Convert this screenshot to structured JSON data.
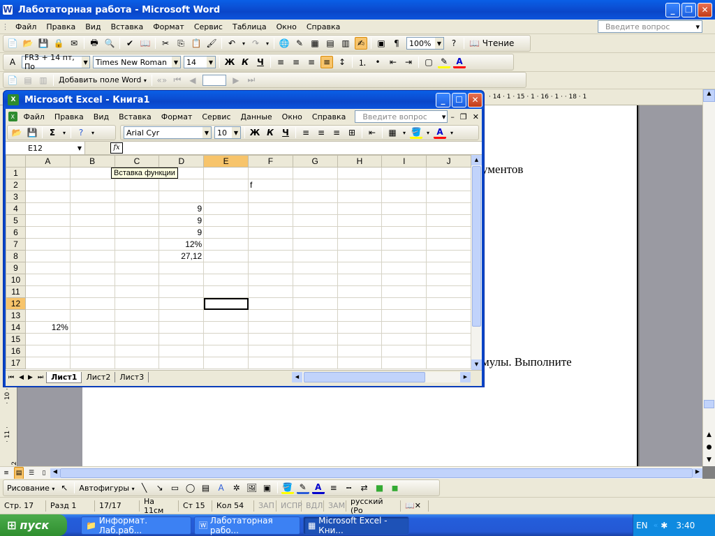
{
  "word": {
    "title": "Лаботаторная работа - Microsoft Word",
    "menu": [
      "Файл",
      "Правка",
      "Вид",
      "Вставка",
      "Формат",
      "Сервис",
      "Таблица",
      "Окно",
      "Справка"
    ],
    "ask_placeholder": "Введите вопрос",
    "zoom": "100%",
    "reading": "Чтение",
    "style": "FR3 + 14 пт, По",
    "font": "Times New Roman",
    "size": "14",
    "add_field": "Добавить поле Word",
    "ruler_text": "· 14 · 1 · 15 · 1 · 16 · 1 ·   · 18 · 1",
    "doc_line1": "ументов",
    "doc_line2": "мулы.  Выполните",
    "vruler": [
      "· 10 ·",
      "· 11 ·",
      "· 12 ·"
    ],
    "drawing": "Рисование",
    "autoshapes": "Автофигуры",
    "status": [
      "Стр. 17",
      "Разд 1",
      "17/17",
      "На 11см",
      "Ст 15",
      "Кол 54",
      "ЗАП",
      "ИСПР",
      "ВДЛ",
      "ЗАМ",
      "русский (Ро"
    ]
  },
  "excel": {
    "title": "Microsoft Excel - Книга1",
    "menu": [
      "Файл",
      "Правка",
      "Вид",
      "Вставка",
      "Формат",
      "Сервис",
      "Данные",
      "Окно",
      "Справка"
    ],
    "ask_placeholder": "Введите вопрос",
    "font": "Arial Cyr",
    "size": "10",
    "namebox": "E12",
    "fx": "fx",
    "tooltip": "Вставка функции",
    "columns": [
      "A",
      "B",
      "C",
      "D",
      "E",
      "F",
      "G",
      "H",
      "I",
      "J"
    ],
    "rows": [
      [
        "1",
        "",
        "",
        "",
        "",
        "",
        "",
        "",
        "",
        "",
        ""
      ],
      [
        "2",
        "",
        "",
        "",
        "",
        "",
        "f",
        "",
        "",
        "",
        ""
      ],
      [
        "3",
        "",
        "",
        "",
        "",
        "",
        "",
        "",
        "",
        "",
        ""
      ],
      [
        "4",
        "",
        "",
        "",
        "9",
        "",
        "",
        "",
        "",
        "",
        ""
      ],
      [
        "5",
        "",
        "",
        "",
        "9",
        "",
        "",
        "",
        "",
        "",
        ""
      ],
      [
        "6",
        "",
        "",
        "",
        "9",
        "",
        "",
        "",
        "",
        "",
        ""
      ],
      [
        "7",
        "",
        "",
        "",
        "12%",
        "",
        "",
        "",
        "",
        "",
        ""
      ],
      [
        "8",
        "",
        "",
        "",
        "27,12",
        "",
        "",
        "",
        "",
        "",
        ""
      ],
      [
        "9",
        "",
        "",
        "",
        "",
        "",
        "",
        "",
        "",
        "",
        ""
      ],
      [
        "10",
        "",
        "",
        "",
        "",
        "",
        "",
        "",
        "",
        "",
        ""
      ],
      [
        "11",
        "",
        "",
        "",
        "",
        "",
        "",
        "",
        "",
        "",
        ""
      ],
      [
        "12",
        "",
        "",
        "",
        "",
        "",
        "",
        "",
        "",
        "",
        ""
      ],
      [
        "13",
        "",
        "",
        "",
        "",
        "",
        "",
        "",
        "",
        "",
        ""
      ],
      [
        "14",
        "12%",
        "",
        "",
        "",
        "",
        "",
        "",
        "",
        "",
        ""
      ],
      [
        "15",
        "",
        "",
        "",
        "",
        "",
        "",
        "",
        "",
        "",
        ""
      ],
      [
        "16",
        "",
        "",
        "",
        "",
        "",
        "",
        "",
        "",
        "",
        ""
      ],
      [
        "17",
        "",
        "",
        "",
        "",
        "",
        "",
        "",
        "",
        "",
        ""
      ]
    ],
    "selected_cell": "E12",
    "sheets": [
      "Лист1",
      "Лист2",
      "Лист3"
    ]
  },
  "taskbar": {
    "start": "пуск",
    "items": [
      "Информат. Лаб.раб...",
      "Лаботаторная рабо...",
      "Microsoft Excel - Кни..."
    ],
    "lang": "EN",
    "clock": "3:40"
  }
}
